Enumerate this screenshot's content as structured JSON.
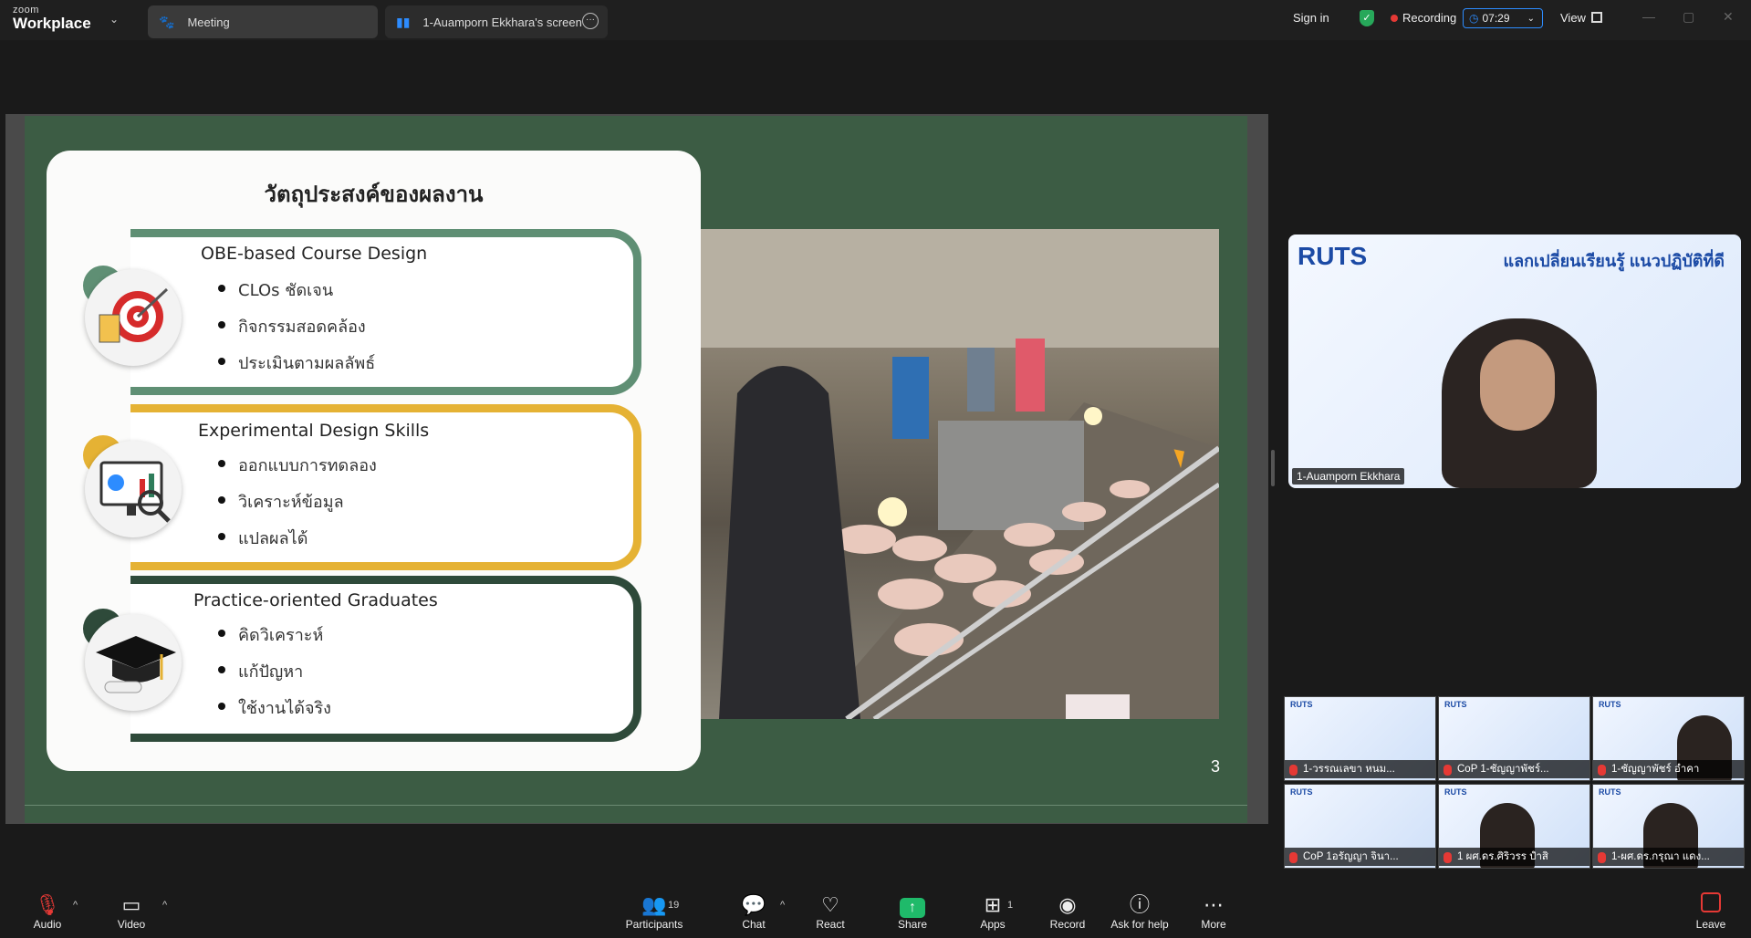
{
  "app": {
    "brand_small": "zoom",
    "brand_large": "Workplace"
  },
  "tabs": [
    {
      "label": "Meeting"
    },
    {
      "label": "1-Auamporn Ekkhara's screen"
    }
  ],
  "top_right": {
    "signin": "Sign in",
    "recording": "Recording",
    "timer": "07:29",
    "view": "View"
  },
  "slide": {
    "title": "วัตถุประสงค์ของผลงาน",
    "sections": [
      {
        "title": "OBE-based Course Design",
        "bullets": [
          "CLOs ชัดเจน",
          "กิจกรรมสอดคล้อง",
          "ประเมินตามผลลัพธ์"
        ]
      },
      {
        "title": "Experimental Design Skills",
        "bullets": [
          "ออกแบบการทดลอง",
          "วิเคราะห์ข้อมูล",
          "แปลผลได้"
        ]
      },
      {
        "title": "Practice-oriented Graduates",
        "bullets": [
          "คิดวิเคราะห์",
          "แก้ปัญหา",
          "ใช้งานได้จริง"
        ]
      }
    ],
    "page_number": "3"
  },
  "speaker": {
    "name": "1-Auamporn Ekkhara",
    "bg_logo": "RUTS",
    "bg_heading": "แลกเปลี่ยนเรียนรู้ แนวปฏิบัติที่ดี"
  },
  "participants_grid": [
    {
      "name": "1-วรรณเลขา หนม..."
    },
    {
      "name": "CoP 1-ชัญญาพัชร์..."
    },
    {
      "name": "1-ชัญญาพัชร์ อำคา"
    },
    {
      "name": "CoP 1อรัญญา จินา..."
    },
    {
      "name": "1 ผศ.ดร.ศิริวรร ปำสิ"
    },
    {
      "name": "1-ผศ.ดร.กรุณา แดง..."
    }
  ],
  "controls": {
    "audio": "Audio",
    "video": "Video",
    "participants": "Participants",
    "participants_count": "19",
    "chat": "Chat",
    "react": "React",
    "share": "Share",
    "apps": "Apps",
    "apps_count": "1",
    "record": "Record",
    "help": "Ask for help",
    "more": "More",
    "leave": "Leave"
  },
  "colors": {
    "slide_bg": "#3c5c44",
    "sec1": "#5f8f74",
    "sec2": "#e5b234",
    "sec3": "#2e4a3a",
    "share_green": "#1fba6a",
    "rec_red": "#e53935",
    "accent_blue": "#2d8cff"
  }
}
